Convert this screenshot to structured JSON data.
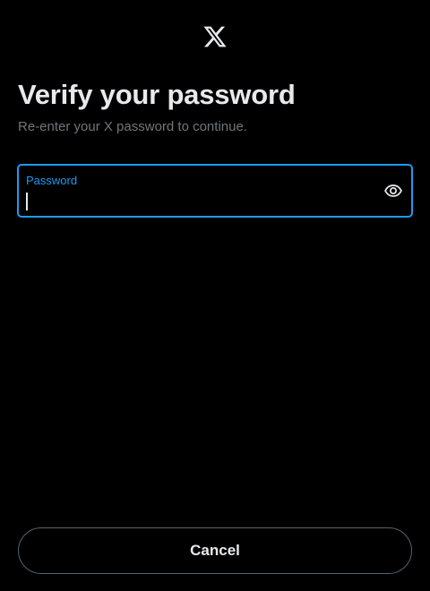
{
  "brand": {
    "logo_icon": "x-logo-icon",
    "color": "#e7e9ea"
  },
  "header": {
    "title": "Verify your password",
    "subtitle": "Re-enter your X password to continue."
  },
  "password_field": {
    "label": "Password",
    "value": "",
    "toggle_icon": "eye-icon",
    "accent_color": "#1d9bf0"
  },
  "footer": {
    "cancel_label": "Cancel"
  }
}
